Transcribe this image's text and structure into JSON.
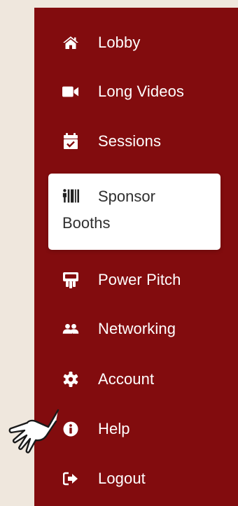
{
  "sidebar": {
    "items": [
      {
        "label": "Lobby",
        "icon": "home-icon"
      },
      {
        "label": "Long Videos",
        "icon": "video-camera-icon"
      },
      {
        "label": "Sessions",
        "icon": "calendar-check-icon"
      },
      {
        "label": "Sponsor",
        "label2": "Booths",
        "icon": "sponsor-booth-icon",
        "active": true
      },
      {
        "label": "Power Pitch",
        "icon": "presentation-icon"
      },
      {
        "label": "Networking",
        "icon": "users-icon"
      },
      {
        "label": "Account",
        "icon": "gear-icon"
      },
      {
        "label": "Help",
        "icon": "info-circle-icon"
      },
      {
        "label": "Logout",
        "icon": "sign-out-icon"
      }
    ]
  },
  "colors": {
    "sidebar_bg": "#820c0e",
    "page_bg": "#efe7dd",
    "active_bg": "#ffffff",
    "active_text": "#2f2f2f",
    "item_text": "#ffffff"
  }
}
